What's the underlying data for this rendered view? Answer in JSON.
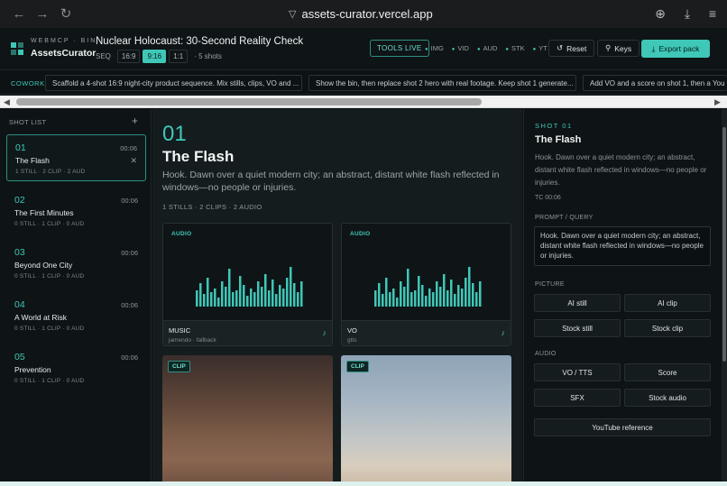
{
  "browser": {
    "url": "assets-curator.vercel.app",
    "icons": [
      "back-arrow-icon",
      "forward-arrow-icon",
      "reload-icon",
      "shield-icon",
      "add-icon",
      "download-icon",
      "menu-icon"
    ]
  },
  "header": {
    "brand_small": "WEBMCP · BIN",
    "brand": "AssetsCurator",
    "project_title": "Nuclear Holocaust: 30-Second Reality Check",
    "seq_label": "SEQ",
    "ratios": [
      "16:9",
      "9:16",
      "1:1"
    ],
    "active_ratio": "9:16",
    "shots_count": "· 5 shots",
    "tools_live": "TOOLS LIVE",
    "capabilities": [
      "IMG",
      "VID",
      "AUD",
      "STK",
      "YT"
    ],
    "reset_label": "Reset",
    "keys_label": "Keys",
    "export_label": "Export pack",
    "accent_color": "#3fc7b7"
  },
  "cowork": {
    "label": "COWORK",
    "chips": [
      "Scaffold a 4-shot 16:9 night-city product sequence. Mix stills, clips, VO and ...",
      "Show the bin, then replace shot 2 hero with real footage. Keep shot 1 generate...",
      "Add VO and a score on shot 1, then a You"
    ]
  },
  "shot_list": {
    "heading": "SHOT LIST",
    "add_label": "+",
    "shots": [
      {
        "num": "01",
        "name": "The Flash",
        "time": "00:06",
        "meta": "1 STILL · 2 CLIP · 2 AUD"
      },
      {
        "num": "02",
        "name": "The First Minutes",
        "time": "00:06",
        "meta": "0 STILL · 1 CLIP · 0 AUD"
      },
      {
        "num": "03",
        "name": "Beyond One City",
        "time": "00:06",
        "meta": "0 STILL · 1 CLIP · 0 AUD"
      },
      {
        "num": "04",
        "name": "A World at Risk",
        "time": "00:06",
        "meta": "0 STILL · 1 CLIP · 0 AUD"
      },
      {
        "num": "05",
        "name": "Prevention",
        "time": "00:06",
        "meta": "0 STILL · 1 CLIP · 0 AUD"
      }
    ]
  },
  "main": {
    "number": "01",
    "title": "The Flash",
    "description": "Hook. Dawn over a quiet modern city; an abstract, distant white flash reflected in windows—no people or injuries.",
    "counts": "1 STILLS · 2 CLIPS · 2 AUDIO",
    "audio_cards": [
      {
        "tag": "AUDIO",
        "name": "MUSIC",
        "source": "jamendo · fallback"
      },
      {
        "tag": "AUDIO",
        "name": "VO",
        "source": "gtts"
      }
    ],
    "clip_cards": [
      {
        "tag": "CLIP"
      },
      {
        "tag": "CLIP"
      }
    ]
  },
  "panel": {
    "kicker": "SHOT 01",
    "title": "The Flash",
    "description": "Hook. Dawn over a quiet modern city; an abstract, distant white flash reflected in windows—no people or injuries.",
    "tc": "TC 00:06",
    "prompt_heading": "PROMPT / QUERY",
    "prompt_value": "Hook. Dawn over a quiet modern city; an abstract, distant white flash reflected in windows—no people or injuries.",
    "picture_heading": "PICTURE",
    "picture_buttons": [
      "AI still",
      "AI clip",
      "Stock still",
      "Stock clip"
    ],
    "audio_heading": "AUDIO",
    "audio_buttons": [
      "VO / TTS",
      "Score",
      "SFX",
      "Stock audio"
    ],
    "youtube_label": "YouTube reference"
  }
}
